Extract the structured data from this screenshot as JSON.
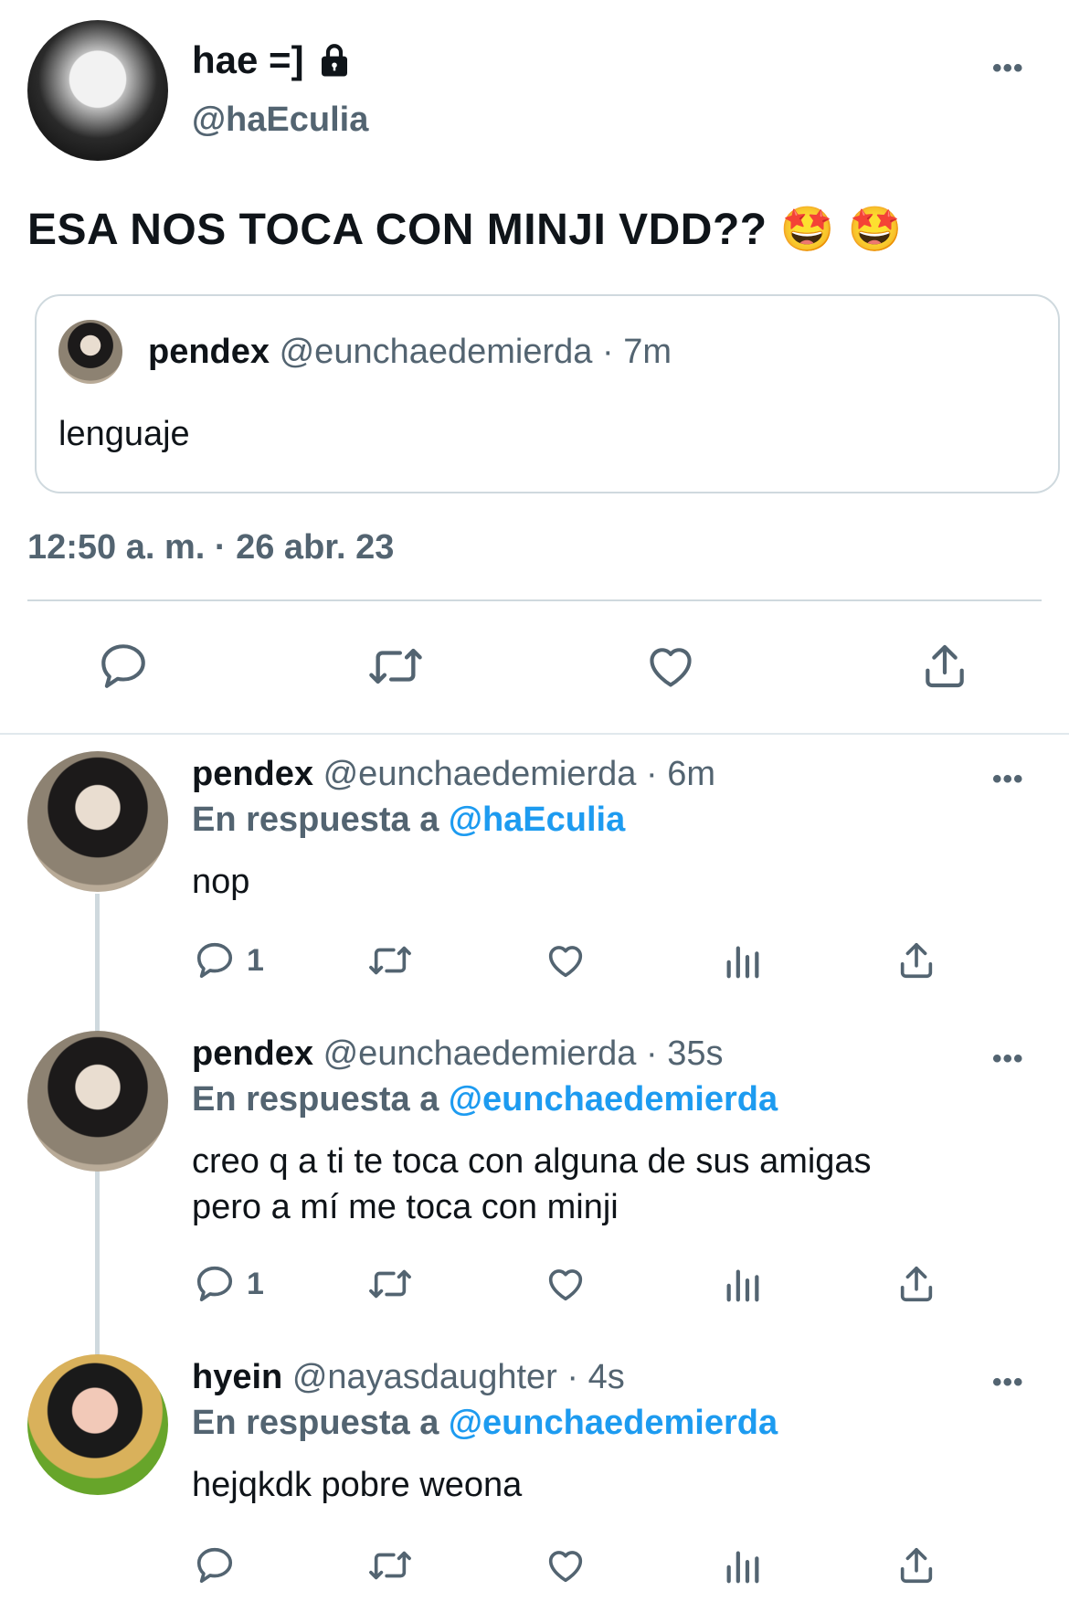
{
  "main_tweet": {
    "display_name": "hae =]",
    "handle": "@haEculia",
    "text": "ESA NOS TOCA CON MINJI VDD?? 🤩 🤩",
    "timestamp": "12:50 a. m. · 26 abr. 23",
    "quoted": {
      "display_name": "pendex",
      "handle": "@eunchaedemierda",
      "time": "· 7m",
      "text": "lenguaje"
    }
  },
  "replies": [
    {
      "display_name": "pendex",
      "handle": "@eunchaedemierda",
      "time": "· 6m",
      "reply_prefix": "En respuesta a",
      "reply_to": "@haEculia",
      "text": "nop",
      "reply_count": "1"
    },
    {
      "display_name": "pendex",
      "handle": "@eunchaedemierda",
      "time": "· 35s",
      "reply_prefix": "En respuesta a",
      "reply_to": "@eunchaedemierda",
      "text_line1": "creo q a ti te toca con alguna de sus amigas",
      "text_line2": "pero a mí me toca con minji",
      "reply_count": "1"
    },
    {
      "display_name": "hyein",
      "handle": "@nayasdaughter",
      "time": "· 4s",
      "reply_prefix": "En respuesta a",
      "reply_to": "@eunchaedemierda",
      "text": "hejqkdk pobre weona",
      "reply_count": ""
    }
  ],
  "more_label": "•••",
  "colors": {
    "accent": "#1d9bf0",
    "secondary_text": "#536471",
    "border": "#cfd9de"
  },
  "icons": [
    "lock-icon",
    "reply-icon",
    "retweet-icon",
    "like-icon",
    "views-icon",
    "share-icon",
    "more-icon"
  ]
}
